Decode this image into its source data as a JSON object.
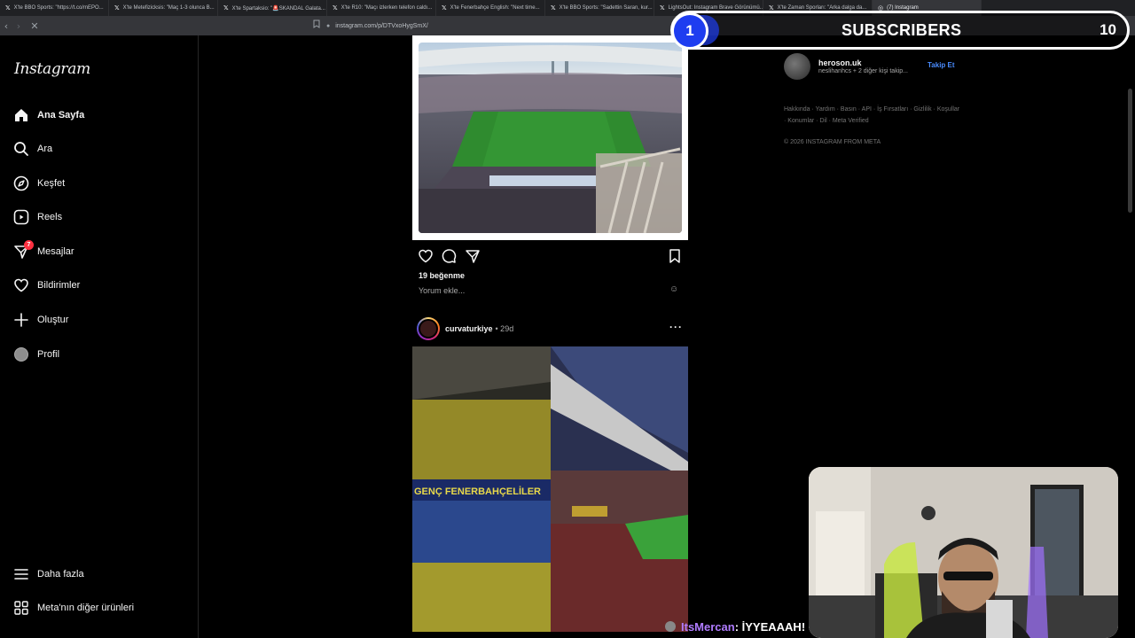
{
  "browser": {
    "tabs": [
      {
        "label": "X'te BBO Sports: \"https://t.co/mEPO...",
        "active": false
      },
      {
        "label": "X'te Metefizicksis: \"Maç 1-3 olunca B...",
        "active": false
      },
      {
        "label": "X'te Spartaksio: \"🚨SKANDAL Galata...",
        "active": false
      },
      {
        "label": "X'te R10: \"Maçı izlerken telefon caldı...",
        "active": false
      },
      {
        "label": "X'te Fenerbahçe English: \"Next time...",
        "active": false
      },
      {
        "label": "X'te BBO Sports: \"Sadettin Saran, kur...",
        "active": false
      },
      {
        "label": "LightsOut: Instagram Brave Görünümü...",
        "active": false
      },
      {
        "label": "X'te Zaman Sporları: \"Arka dalga da...",
        "active": false
      },
      {
        "label": "(7) Instagram",
        "active": true
      }
    ],
    "url": "instagram.com/p/DTVxoHygSmX/"
  },
  "sidebar": {
    "logo": "Instagram",
    "items": [
      {
        "label": "Ana Sayfa",
        "icon": "home-icon",
        "active": true
      },
      {
        "label": "Ara",
        "icon": "search-icon"
      },
      {
        "label": "Keşfet",
        "icon": "compass-icon"
      },
      {
        "label": "Reels",
        "icon": "reels-icon"
      },
      {
        "label": "Mesajlar",
        "icon": "messenger-icon",
        "badge": "7"
      },
      {
        "label": "Bildirimler",
        "icon": "heart-icon"
      },
      {
        "label": "Oluştur",
        "icon": "plus-icon"
      },
      {
        "label": "Profil",
        "icon": "profile-avatar"
      }
    ],
    "bottom": [
      {
        "label": "Daha fazla",
        "icon": "menu-icon"
      },
      {
        "label": "Meta'nın diğer ürünleri",
        "icon": "grid-icon"
      }
    ]
  },
  "feed": {
    "post1": {
      "likes": "19 beğenme",
      "comment_placeholder": "Yorum ekle..."
    },
    "post2": {
      "username": "curvaturkiye",
      "time": "• 29d",
      "banner_text": "GENÇ FENERBAHÇELİLER"
    }
  },
  "right": {
    "suggestion": {
      "name": "heroson.uk",
      "subtitle": "neslihanhcs + 2 diğer kişi takip...",
      "follow_label": "Takip Et"
    },
    "partial_top": "",
    "footer_links": "Hakkında · Yardım · Basın · API · İş Fırsatları · Gizlilik · Koşullar · Konumlar · Dil · Meta Verified",
    "copyright": "© 2026 INSTAGRAM FROM META"
  },
  "overlay": {
    "sub_number": "1",
    "sub_label": "SUBSCRIBERS",
    "sub_count": "10",
    "chat_user": "ItsMercan",
    "chat_msg": ": İYYEAAAH!"
  },
  "colors": {
    "accent_blue": "#4a8cff",
    "badge_red": "#ff3040",
    "sub_blue": "#1e3df0",
    "chat_purple": "#b07cff"
  }
}
